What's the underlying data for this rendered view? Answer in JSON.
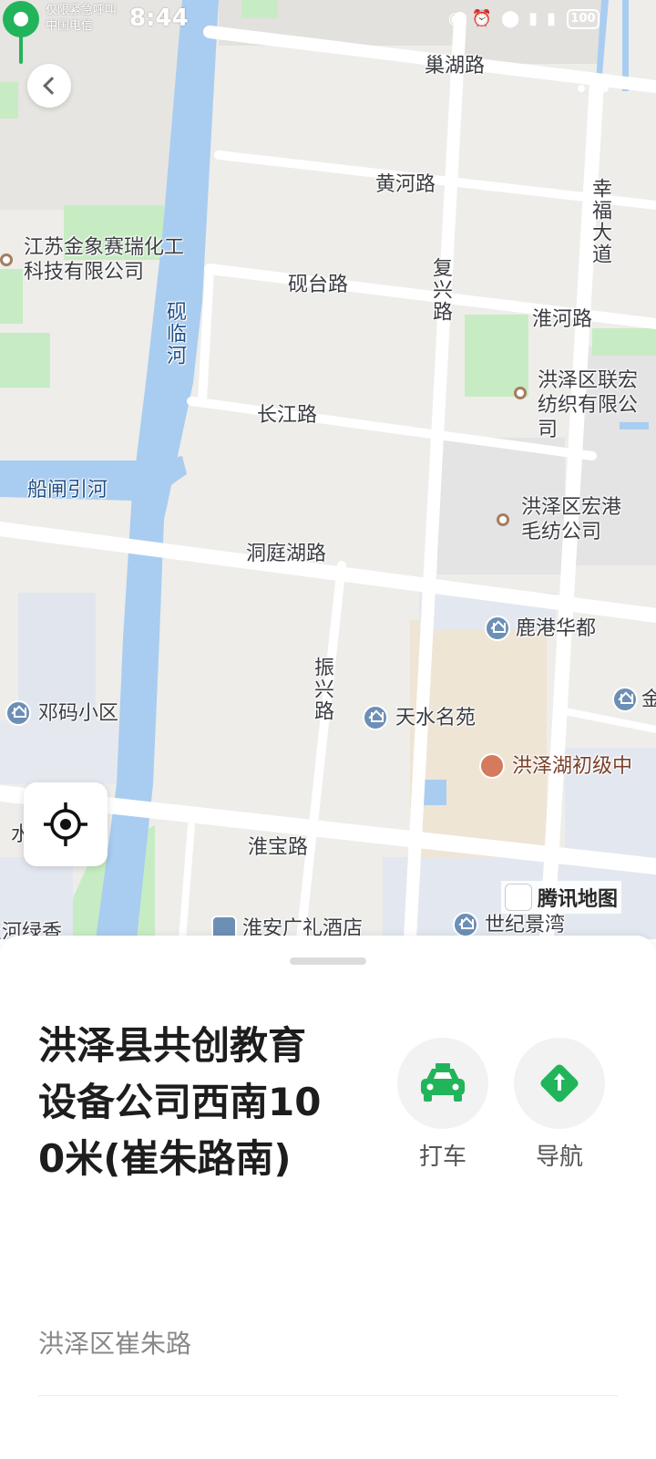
{
  "status_bar": {
    "carrier_line1": "仅限紧急呼叫",
    "carrier_line2": "中国电信",
    "time": "8:44",
    "battery": "100"
  },
  "map": {
    "roads": {
      "chaohu": "巢湖路",
      "huanghe": "黄河路",
      "yantai": "砚台路",
      "fuxing": "复兴路",
      "xingfu": "幸福大道",
      "huaihe": "淮河路",
      "changjiang": "长江路",
      "dongtinghu": "洞庭湖路",
      "zhenxing": "振兴路",
      "huaibao": "淮宝路"
    },
    "water": {
      "yanlinhe": "砚临河",
      "chuanzha": "船闸引河"
    },
    "pois": {
      "jinxiang": "江苏金象赛瑞化工\n科技有限公司",
      "lianhong": "洪泽区联宏\n纺织有限公司",
      "honggang": "洪泽区宏港\n毛纺公司",
      "lugang": "鹿港华都",
      "dengma": "邓码小区",
      "tianshui": "天水名苑",
      "hongzehu_school": "洪泽湖初级中",
      "jin_partial": "金",
      "shui_partial": "水",
      "hotel": "淮安广礼酒店",
      "shiji": "世纪景湾",
      "left_partial": "宝河绿香"
    },
    "attribution": "腾讯地图"
  },
  "place": {
    "title": "洪泽县共创教育设备公司西南100米(崔朱路南)",
    "address": "洪泽区崔朱路"
  },
  "actions": {
    "taxi_label": "打车",
    "navigate_label": "导航"
  },
  "colors": {
    "accent": "#22b45a",
    "water": "#a9cdf0",
    "green_area": "#c7ecc3"
  },
  "icons": {
    "back": "back-chevron-icon",
    "more": "more-dots-icon",
    "locate": "locate-crosshair-icon",
    "taxi": "taxi-icon",
    "navigate": "navigate-arrow-icon",
    "pin": "location-pin-icon"
  }
}
